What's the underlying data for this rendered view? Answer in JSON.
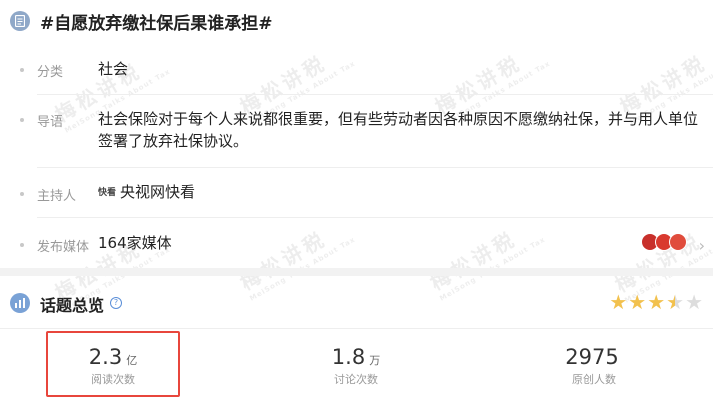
{
  "topic": {
    "title": "#自愿放弃缴社保后果谁承担#"
  },
  "info": {
    "category_label": "分类",
    "category_value": "社会",
    "intro_label": "导语",
    "intro_value": "社会保险对于每个人来说都很重要，但有些劳动者因各种原因不愿缴纳社保，并与用人单位签署了放弃社保协议。",
    "host_label": "主持人",
    "host_logo_text": "快看",
    "host_value": "央视网快看",
    "media_label": "发布媒体",
    "media_value": "164家媒体"
  },
  "media_logo_colors": [
    "#c8302b",
    "#d93a2f",
    "#e04c3c"
  ],
  "overview": {
    "title": "话题总览",
    "help_icon": "question-icon",
    "rating": 3.5,
    "rating_max": 5,
    "star_color": "#f2c14e",
    "star_empty_color": "#dddddd"
  },
  "stats": [
    {
      "value": "2.3",
      "unit": "亿",
      "label": "阅读次数"
    },
    {
      "value": "1.8",
      "unit": "万",
      "label": "讨论次数"
    },
    {
      "value": "2975",
      "unit": "",
      "label": "原创人数"
    }
  ],
  "watermark": {
    "text": "梅松讲税",
    "sub": "MeiSong Talks About Tax"
  },
  "highlight_color": "#e8463c"
}
